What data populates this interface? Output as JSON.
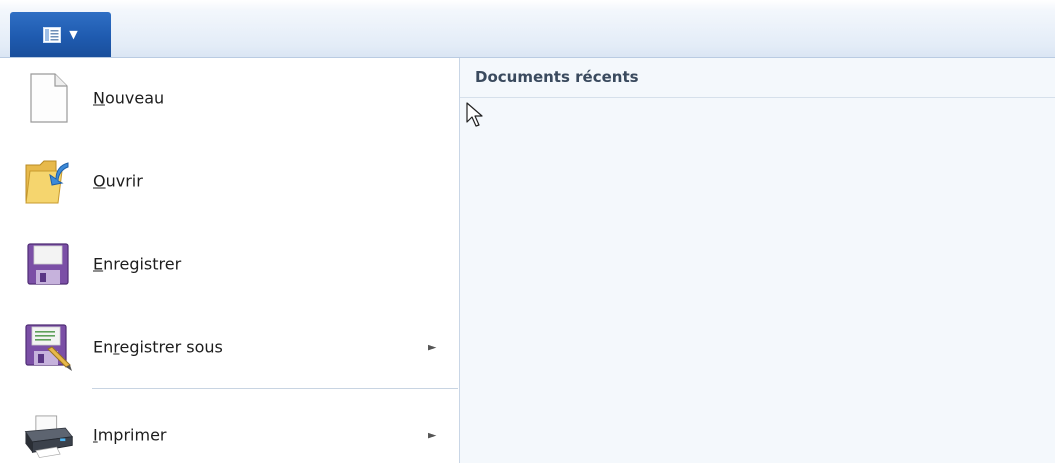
{
  "app_menu": {
    "button_icon": "document-menu-icon",
    "caret_icon": "chevron-down-icon",
    "caret_glyph": "▼"
  },
  "menu": {
    "items": [
      {
        "pre": "",
        "key": "N",
        "post": "ouveau",
        "icon": "new-document-icon",
        "has_submenu": false
      },
      {
        "pre": "",
        "key": "O",
        "post": "uvrir",
        "icon": "open-folder-icon",
        "has_submenu": false
      },
      {
        "pre": "",
        "key": "E",
        "post": "nregistrer",
        "icon": "save-disk-icon",
        "has_submenu": false
      },
      {
        "pre": "En",
        "key": "r",
        "post": "egistrer sous",
        "icon": "save-as-icon",
        "has_submenu": true
      },
      {
        "pre": "",
        "key": "I",
        "post": "mprimer",
        "icon": "printer-icon",
        "has_submenu": true
      }
    ],
    "submenu_arrow": "►"
  },
  "recent": {
    "title": "Documents récents"
  }
}
